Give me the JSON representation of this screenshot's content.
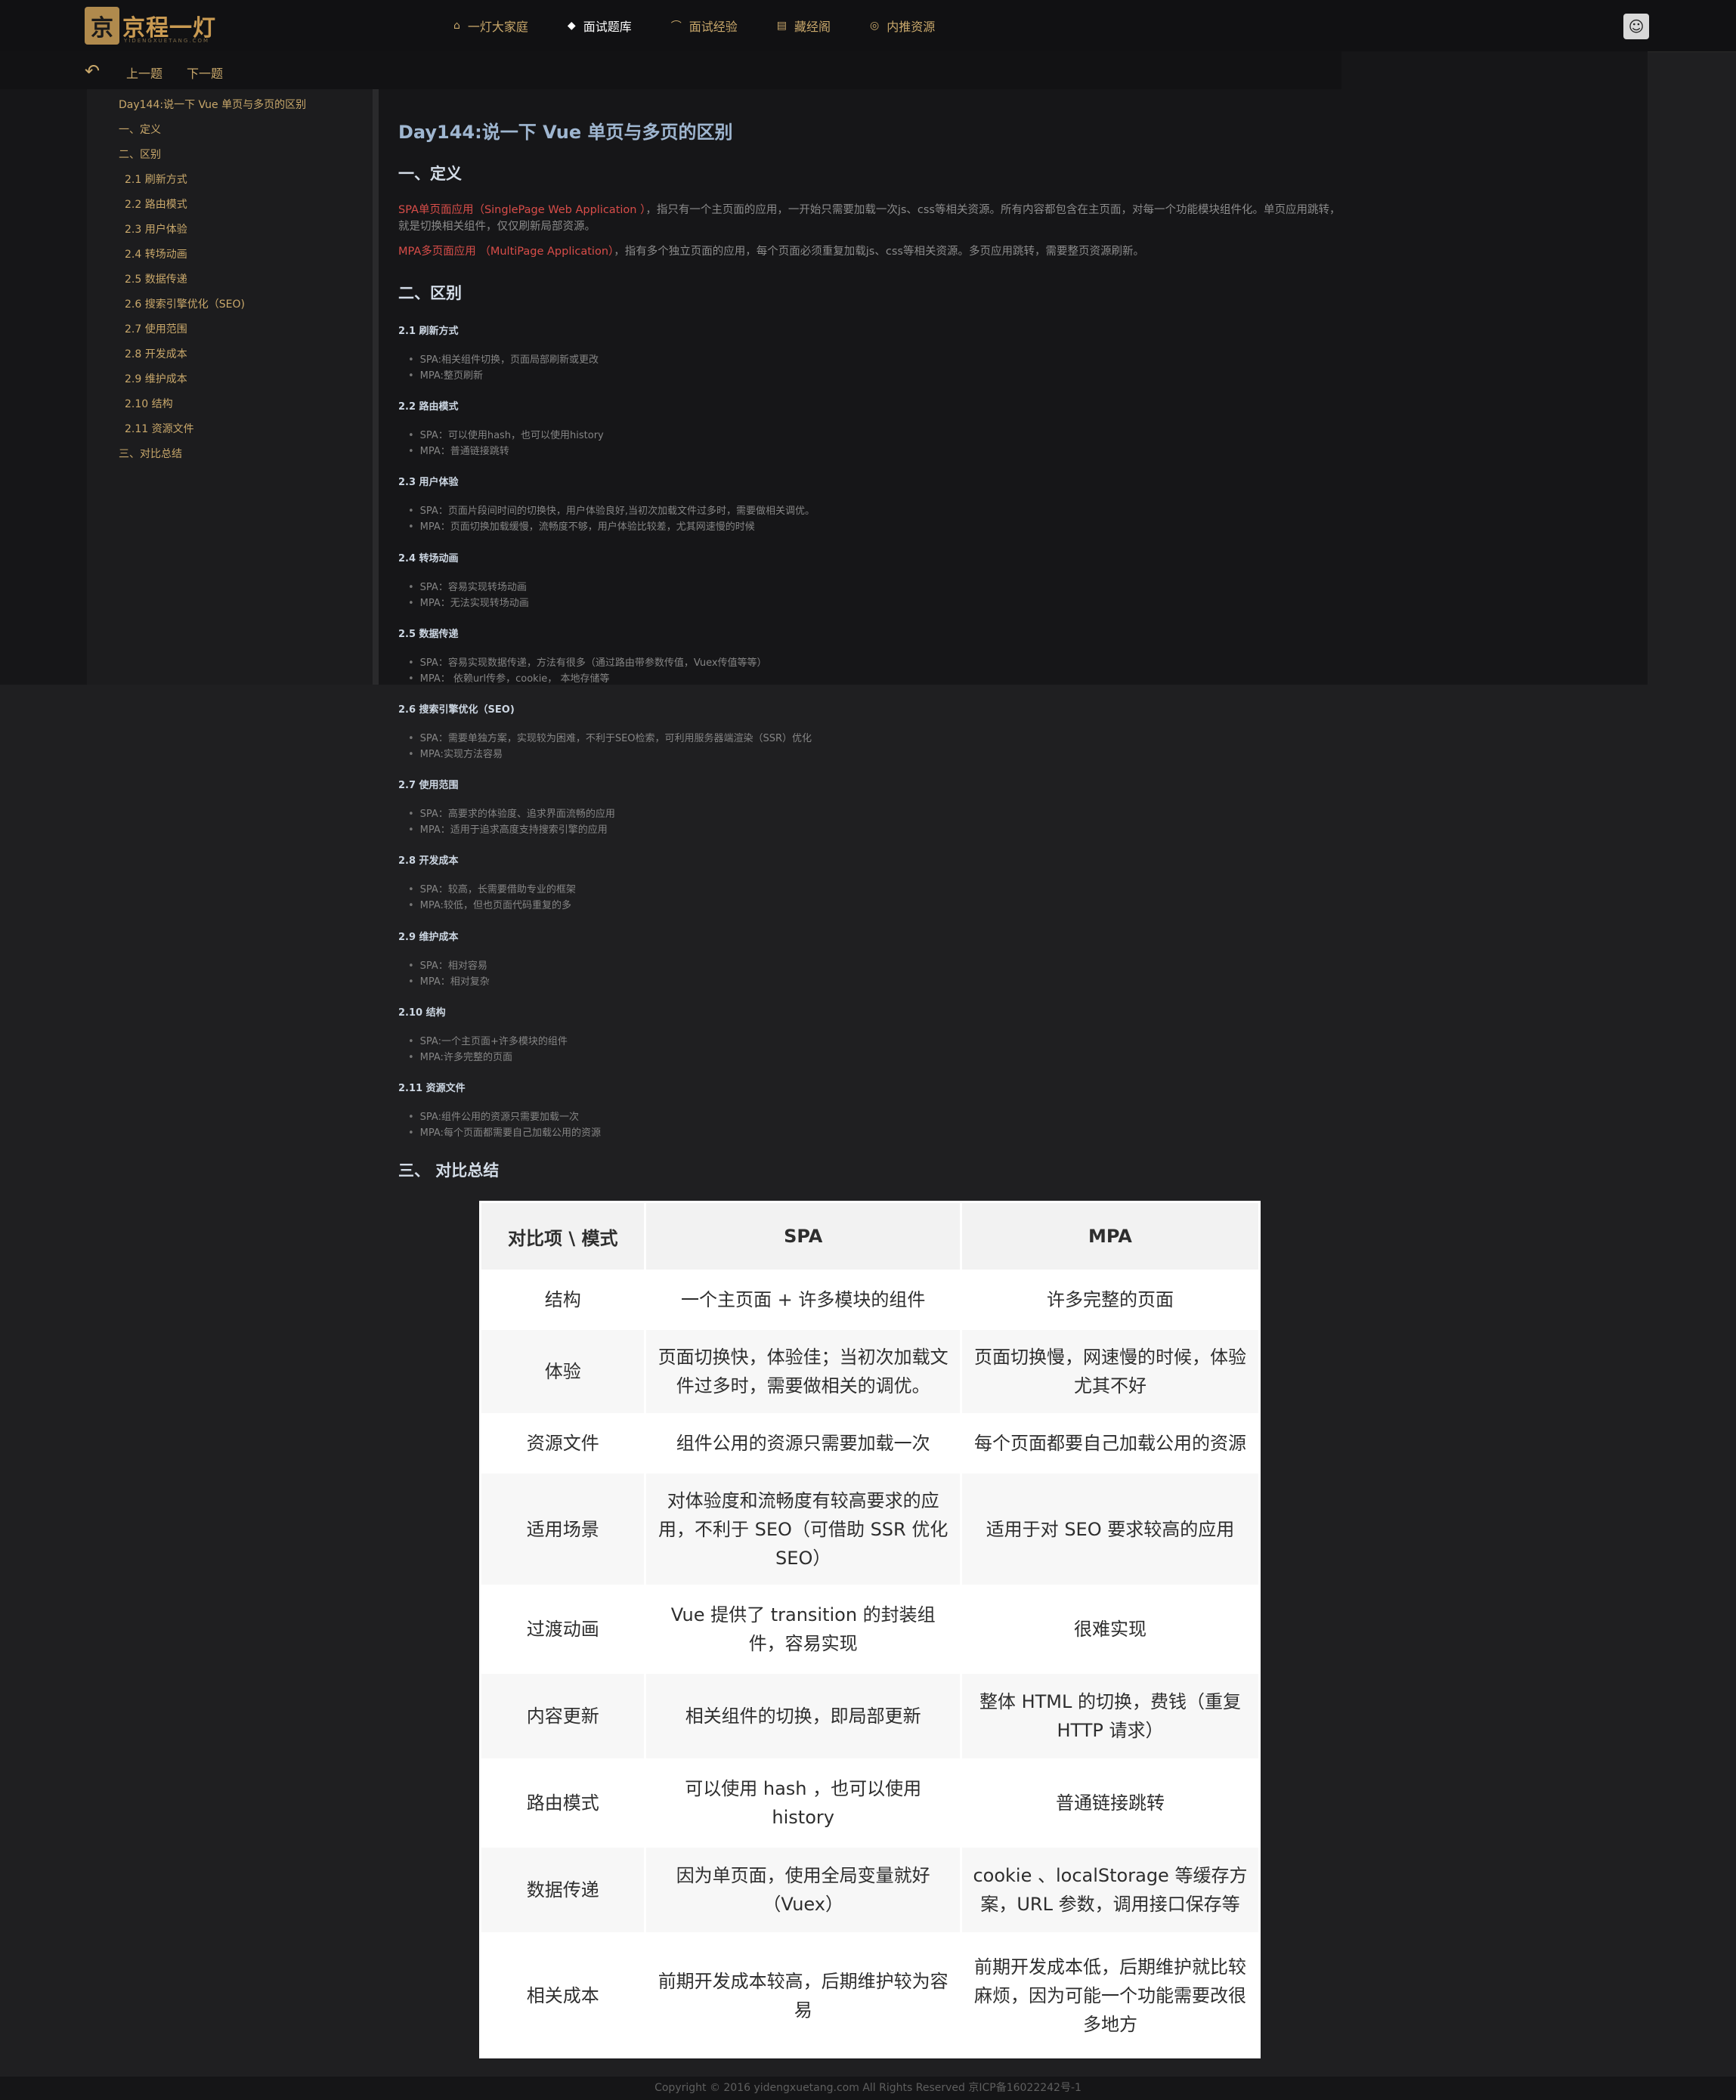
{
  "header": {
    "logo_mark": "京",
    "logo_text": "京程一灯",
    "logo_sub": "YIDENGXUETANG.COM",
    "nav": [
      {
        "icon": "⌂",
        "label": "一灯大家庭"
      },
      {
        "icon": "◆",
        "label": "面试题库"
      },
      {
        "icon": "⌒",
        "label": "面试经验"
      },
      {
        "icon": "▤",
        "label": "藏经阁"
      },
      {
        "icon": "◎",
        "label": "内推资源"
      }
    ],
    "active_nav": 1
  },
  "subbar": {
    "back_icon": "↶",
    "prev": "上一题",
    "next": "下一题"
  },
  "toc": [
    {
      "label": "Day144:说一下 Vue 单页与多页的区别",
      "level": 1
    },
    {
      "label": "一、定义",
      "level": 1
    },
    {
      "label": "二、区别",
      "level": 1
    },
    {
      "label": "2.1 刷新方式",
      "level": 2
    },
    {
      "label": "2.2 路由模式",
      "level": 2
    },
    {
      "label": "2.3 用户体验",
      "level": 2
    },
    {
      "label": "2.4 转场动画",
      "level": 2
    },
    {
      "label": "2.5 数据传递",
      "level": 2
    },
    {
      "label": "2.6 搜索引擎优化（SEO)",
      "level": 2
    },
    {
      "label": "2.7 使用范围",
      "level": 2
    },
    {
      "label": "2.8 开发成本",
      "level": 2
    },
    {
      "label": "2.9 维护成本",
      "level": 2
    },
    {
      "label": "2.10 结构",
      "level": 2
    },
    {
      "label": "2.11 资源文件",
      "level": 2
    },
    {
      "label": "三、对比总结",
      "level": 1
    }
  ],
  "article": {
    "title": "Day144:说一下 Vue 单页与多页的区别",
    "sec1": "一、定义",
    "spa_term": "SPA单页面应用（SinglePage Web Application ）",
    "spa_def": "，指只有一个主页面的应用，一开始只需要加载一次js、css等相关资源。所有内容都包含在主页面，对每一个功能模块组件化。单页应用跳转，就是切换相关组件，仅仅刷新局部资源。",
    "mpa_term": "MPA多页面应用 （MultiPage Application）",
    "mpa_def": "，指有多个独立页面的应用，每个页面必须重复加载js、css等相关资源。多页应用跳转，需要整页资源刷新。",
    "sec2": "二、区别",
    "subs": [
      {
        "title": "2.1 刷新方式",
        "items": [
          "SPA:相关组件切换，页面局部刷新或更改",
          "MPA:整页刷新"
        ]
      },
      {
        "title": "2.2 路由模式",
        "items": [
          "SPA：可以使用hash，也可以使用history",
          "MPA：普通链接跳转"
        ]
      },
      {
        "title": "2.3 用户体验",
        "items": [
          "SPA：页面片段间时间的切换快，用户体验良好,当初次加载文件过多时，需要做相关调优。",
          "MPA：页面切换加载缓慢，流畅度不够，用户体验比较差，尤其网速慢的时候"
        ]
      },
      {
        "title": "2.4 转场动画",
        "items": [
          "SPA：容易实现转场动画",
          "MPA：无法实现转场动画"
        ]
      },
      {
        "title": "2.5 数据传递",
        "items": [
          "SPA：容易实现数据传递，方法有很多（通过路由带参数传值，Vuex传值等等）",
          "MPA： 依赖url传参，cookie， 本地存储等"
        ]
      },
      {
        "title": "2.6 搜索引擎优化（SEO)",
        "items": [
          "SPA：需要单独方案，实现较为困难，不利于SEO检索，可利用服务器端渲染（SSR）优化",
          "MPA:实现方法容易"
        ]
      },
      {
        "title": "2.7 使用范围",
        "items": [
          "SPA：高要求的体验度、追求界面流畅的应用",
          "MPA：适用于追求高度支持搜索引擎的应用"
        ]
      },
      {
        "title": "2.8 开发成本",
        "items": [
          "SPA：较高，长需要借助专业的框架",
          "MPA:较低，但也页面代码重复的多"
        ]
      },
      {
        "title": "2.9 维护成本",
        "items": [
          "SPA：相对容易",
          "MPA：相对复杂"
        ]
      },
      {
        "title": "2.10 结构",
        "items": [
          "SPA:一个主页面+许多模块的组件",
          "MPA:许多完整的页面"
        ]
      },
      {
        "title": "2.11 资源文件",
        "items": [
          "SPA:组件公用的资源只需要加载一次",
          "MPA:每个页面都需要自己加载公用的资源"
        ]
      }
    ],
    "sec3": "三、 对比总结"
  },
  "table": {
    "headers": [
      "对比项 \\ 模式",
      "SPA",
      "MPA"
    ],
    "rows": [
      [
        "结构",
        "一个主页面 + 许多模块的组件",
        "许多完整的页面"
      ],
      [
        "体验",
        "页面切换快，体验佳；当初次加载文件过多时，需要做相关的调优。",
        "页面切换慢，网速慢的时候，体验尤其不好"
      ],
      [
        "资源文件",
        "组件公用的资源只需要加载一次",
        "每个页面都要自己加载公用的资源"
      ],
      [
        "适用场景",
        "对体验度和流畅度有较高要求的应用，不利于 SEO（可借助 SSR 优化 SEO）",
        "适用于对 SEO 要求较高的应用"
      ],
      [
        "过渡动画",
        "Vue 提供了 transition 的封装组件，容易实现",
        "很难实现"
      ],
      [
        "内容更新",
        "相关组件的切换，即局部更新",
        "整体 HTML 的切换，费钱（重复 HTTP 请求）"
      ],
      [
        "路由模式",
        "可以使用 hash ，也可以使用 history",
        "普通链接跳转"
      ],
      [
        "数据传递",
        "因为单页面，使用全局变量就好（Vuex）",
        "cookie 、localStorage 等缓存方案，URL 参数，调用接口保存等"
      ],
      [
        "相关成本",
        "前期开发成本较高，后期维护较为容易",
        "前期开发成本低，后期维护就比较麻烦，因为可能一个功能需要改很多地方"
      ]
    ]
  },
  "footer": "Copyright © 2016 yidengxuetang.com All Rights Reserved 京ICP备16022242号-1"
}
